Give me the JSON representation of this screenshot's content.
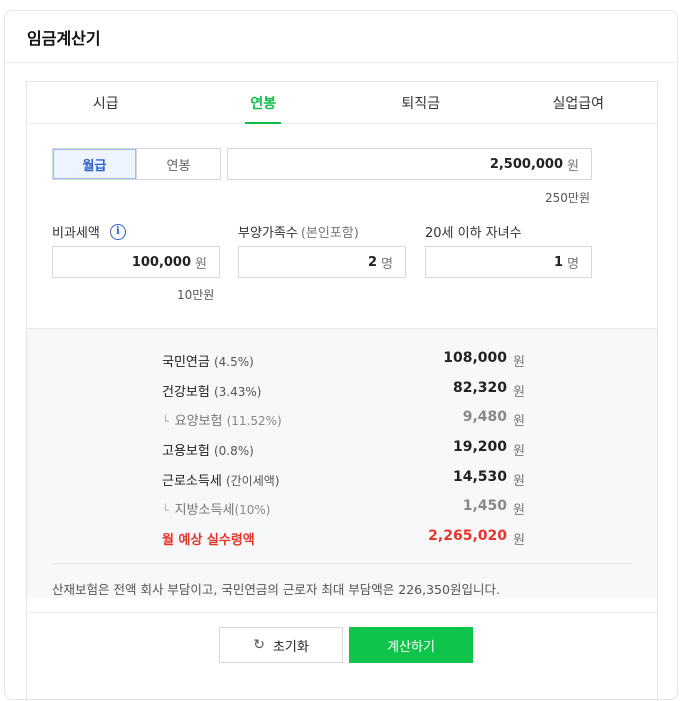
{
  "title": "임금계산기",
  "tabs": [
    {
      "label": "시급",
      "active": false
    },
    {
      "label": "연봉",
      "active": true
    },
    {
      "label": "퇴직금",
      "active": false
    },
    {
      "label": "실업급여",
      "active": false
    }
  ],
  "pay_type": {
    "monthly": "월급",
    "annual": "연봉",
    "selected": "월급"
  },
  "salary": {
    "value": "2,500,000",
    "unit": "원",
    "hint": "250만원"
  },
  "non_taxable": {
    "label": "비과세액",
    "value": "100,000",
    "unit": "원",
    "hint": "10만원"
  },
  "dependents": {
    "label": "부양가족수",
    "label_sub": "(본인포함)",
    "value": "2",
    "unit": "명"
  },
  "children": {
    "label": "20세 이하 자녀수",
    "value": "1",
    "unit": "명"
  },
  "results": [
    {
      "label": "국민연금",
      "pct": "(4.5%)",
      "value": "108,000",
      "unit": "원"
    },
    {
      "label": "건강보험",
      "pct": "(3.43%)",
      "value": "82,320",
      "unit": "원"
    },
    {
      "label": "요양보험",
      "pct": "(11.52%)",
      "value": "9,480",
      "unit": "원"
    },
    {
      "label": "고용보험",
      "pct": "(0.8%)",
      "value": "19,200",
      "unit": "원"
    },
    {
      "label": "근로소득세",
      "pct": "(간이세액)",
      "value": "14,530",
      "unit": "원"
    },
    {
      "label": "지방소득세",
      "pct": "(10%)",
      "value": "1,450",
      "unit": "원"
    },
    {
      "label": "월 예상 실수령액",
      "pct": "",
      "value": "2,265,020",
      "unit": "원"
    }
  ],
  "sub_marker": "└",
  "info_icon": "i",
  "note": "산재보험은 전액 회사 부담이고, 국민연금의 근로자 최대 부담액은 226,350원입니다.",
  "buttons": {
    "reset": "초기화",
    "reset_icon": "↻",
    "calculate": "계산하기"
  },
  "colors": {
    "accent": "#0ebd4a",
    "selected": "#2b62c9",
    "total": "#e8352c"
  }
}
